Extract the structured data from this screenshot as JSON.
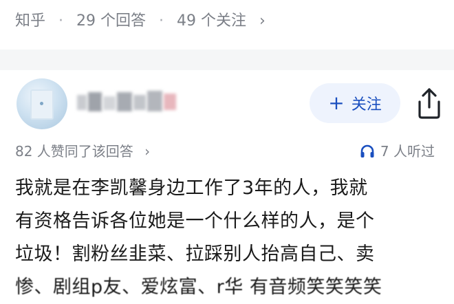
{
  "question_meta": {
    "source": "知乎",
    "separator": "·",
    "answers": "29 个回答",
    "followers": "49 个关注",
    "chevron": "›"
  },
  "answer": {
    "author": {
      "avatar_icon": "avatar-image",
      "name_blurred": true
    },
    "follow_button": {
      "plus": "+",
      "label": "关注"
    },
    "share_icon": "share-icon",
    "likes_text": "82 人赞同了该回答",
    "likes_chevron": "›",
    "listen_icon": "headphones-icon",
    "listen_text": "7 人听过",
    "content_lines": [
      "我就是在李凯馨身边工作了3年的人，我就",
      "有资格告诉各位她是一个什么样的人，是个",
      "垃圾！割粉丝韭菜、拉踩别人抬高自己、卖",
      "惨、剧组p友、爱炫富、r华 有音频笑笑笑笑"
    ]
  },
  "colors": {
    "meta_text": "#7b7f87",
    "follow_bg": "#eef3fd",
    "follow_text": "#1a4fbf",
    "divider_bg": "#f5f6f7",
    "body_text": "#1a1a1a"
  }
}
